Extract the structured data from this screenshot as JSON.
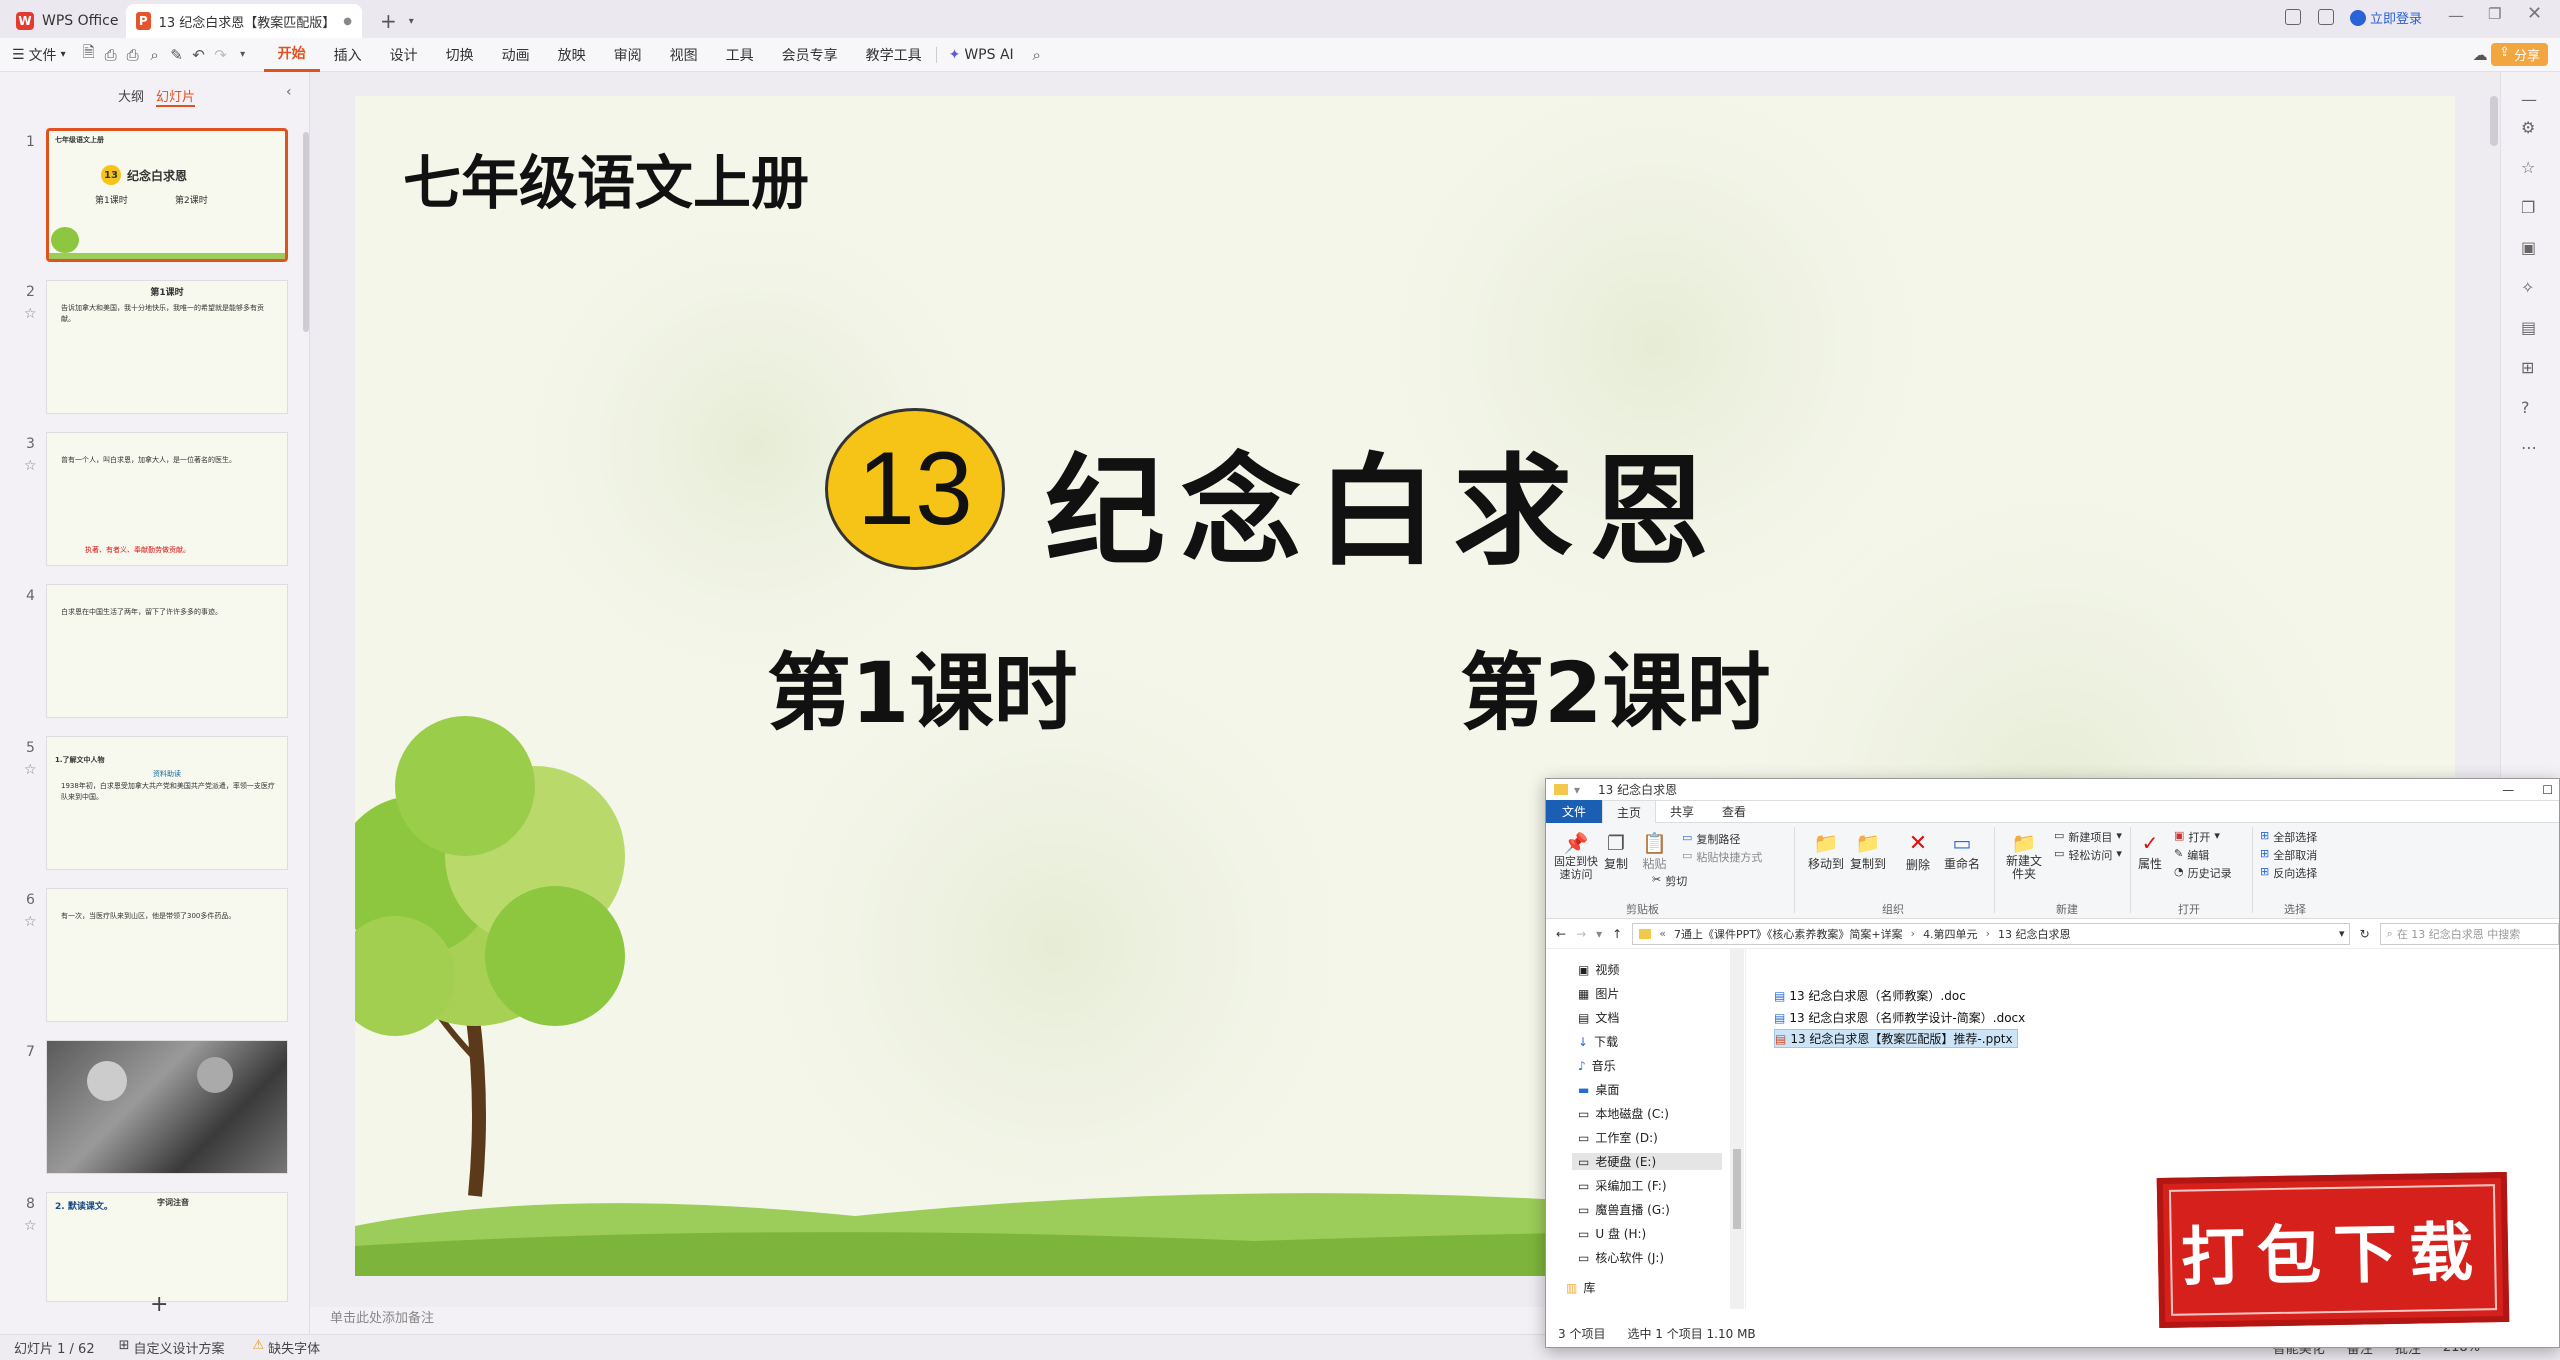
{
  "tabbar": {
    "app_tab": "WPS Office",
    "doc_tab": "13 纪念白求恩【教案匹配版】",
    "add_tab": "+",
    "login": "立即登录"
  },
  "ribbon": {
    "file": "文件",
    "tabs": [
      "开始",
      "插入",
      "设计",
      "切换",
      "动画",
      "放映",
      "审阅",
      "视图",
      "工具",
      "会员专享",
      "教学工具"
    ],
    "wps_ai": "WPS AI",
    "share": "分享"
  },
  "leftpanel": {
    "outline": "大纲",
    "slides": "幻灯片",
    "add": "+",
    "thumbnails": [
      {
        "num": "1",
        "title": "七年级语文上册",
        "main": "纪念白求恩",
        "badge": "13",
        "sub1": "第1课时",
        "sub2": "第2课时"
      },
      {
        "num": "2",
        "title": "第1课时",
        "text": "告诉加拿大和美国，我十分地快乐，我唯一的希望就是能够多有贡献。"
      },
      {
        "num": "3",
        "text": "曾有一个人，叫白求恩，加拿大人，是一位著名的医生。",
        "red": "执著、有者义、奉献勤劳做贡献。"
      },
      {
        "num": "4",
        "text": "白求恩在中国生活了两年，留下了许许多多的事迹。"
      },
      {
        "num": "5",
        "title": "1.了解文中人物",
        "sub": "资料助读",
        "text": "1938年初，白求恩受加拿大共产党和美国共产党派遣，率领一支医疗队来到中国。"
      },
      {
        "num": "6",
        "text": "有一次，当医疗队来到山区，他是带领了300多件药品。"
      },
      {
        "num": "7"
      },
      {
        "num": "8",
        "title": "2. 默读课文。",
        "sub": "字词注音"
      }
    ]
  },
  "slide": {
    "grade": "七年级语文上册",
    "number": "13",
    "title": "纪念白求恩",
    "lesson1": "第1课时",
    "lesson2": "第2课时"
  },
  "notes_placeholder": "单击此处添加备注",
  "statusbar": {
    "slide_count": "幻灯片 1 / 62",
    "design": "自定义设计方案",
    "missing_font": "缺失字体",
    "smart_beautify": "智能美化",
    "notes": "备注",
    "comments": "批注",
    "zoom": "218%"
  },
  "explorer": {
    "title": "13 纪念白求恩",
    "tabs": [
      "文件",
      "主页",
      "共享",
      "查看"
    ],
    "groups": {
      "clipboard": "剪贴板",
      "organize": "组织",
      "new": "新建",
      "open": "打开",
      "select": "选择"
    },
    "buttons": {
      "pin": "固定到快速访问",
      "copy": "复制",
      "paste": "粘贴",
      "copy_path": "复制路径",
      "paste_shortcut": "粘贴快捷方式",
      "cut": "剪切",
      "move_to": "移动到",
      "copy_to": "复制到",
      "delete": "删除",
      "rename": "重命名",
      "new_folder": "新建文件夹",
      "new_item": "新建项目",
      "easy_access": "轻松访问",
      "properties": "属性",
      "open": "打开",
      "edit": "编辑",
      "history": "历史记录",
      "select_all": "全部选择",
      "select_none": "全部取消",
      "invert": "反向选择"
    },
    "path": [
      "7通上《课件PPT》《核心素养教案》简案+详案",
      "4.第四单元",
      "13 纪念白求恩"
    ],
    "search_placeholder": "在 13 纪念白求恩 中搜索",
    "nav": [
      "视频",
      "图片",
      "文档",
      "下载",
      "音乐",
      "桌面",
      "本地磁盘 (C:)",
      "工作室 (D:)",
      "老硬盘 (E:)",
      "采编加工 (F:)",
      "魔兽直播 (G:)",
      "U 盘 (H:)",
      "核心软件 (J:)",
      "库"
    ],
    "files": [
      "13 纪念白求恩（名师教案）.doc",
      "13 纪念白求恩（名师教学设计-简案）.docx",
      "13 纪念白求恩【教案匹配版】推荐-.pptx"
    ],
    "status_items": "3 个项目",
    "status_selected": "选中 1 个项目  1.10 MB"
  },
  "stamp": "打包下载",
  "colors": {
    "accent": "#e0521f",
    "badge": "#f6c416",
    "stamp": "#d6201b"
  }
}
